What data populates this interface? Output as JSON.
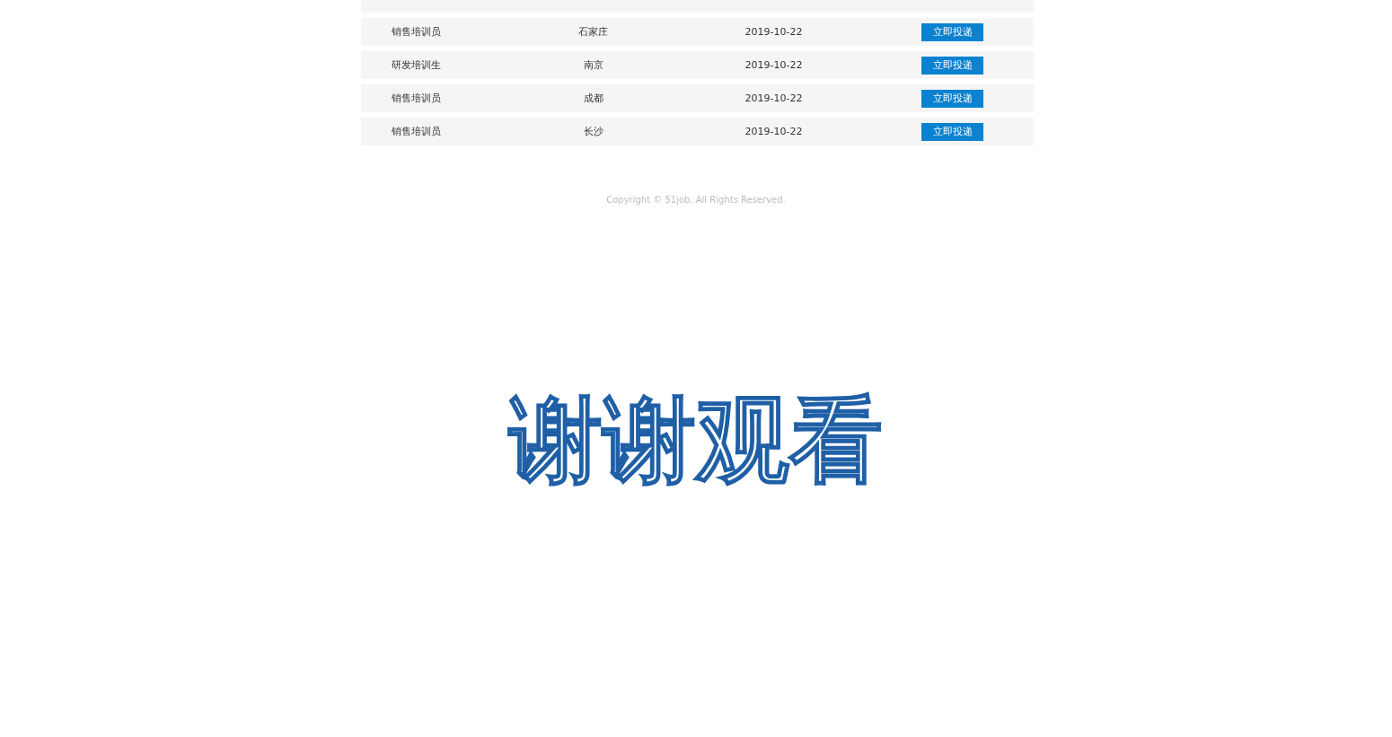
{
  "jobs": [
    {
      "title": "销售培训员",
      "city": "石家庄",
      "date": "2019-10-22",
      "action": "立即投递"
    },
    {
      "title": "研发培训生",
      "city": "南京",
      "date": "2019-10-22",
      "action": "立即投递"
    },
    {
      "title": "销售培训员",
      "city": "成都",
      "date": "2019-10-22",
      "action": "立即投递"
    },
    {
      "title": "销售培训员",
      "city": "长沙",
      "date": "2019-10-22",
      "action": "立即投递"
    }
  ],
  "footer": {
    "copyright": "Copyright © 51job. All Rights Reserved."
  },
  "closing_text": "谢谢观看"
}
